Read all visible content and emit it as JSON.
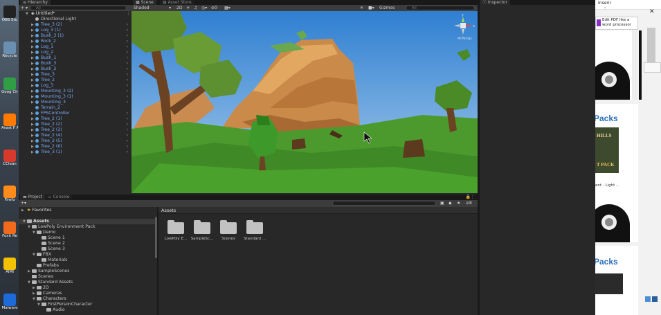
{
  "desktop": {
    "icons": [
      {
        "label": "OBS Stu",
        "color": "#222222"
      },
      {
        "label": "Recycle",
        "color": "#6a8fb0"
      },
      {
        "label": "Goog Chron",
        "color": "#2f9e44"
      },
      {
        "label": "Avast F Antivi",
        "color": "#ff7a00"
      },
      {
        "label": "CClean",
        "color": "#d63a2c"
      },
      {
        "label": "Firefo",
        "color": "#ff8c1a"
      },
      {
        "label": "Foxit Re",
        "color": "#f26b1d"
      },
      {
        "label": "AIMI",
        "color": "#f2c200"
      },
      {
        "label": "Malware",
        "color": "#1d6ad8"
      }
    ]
  },
  "hierarchy": {
    "tab": "Hierarchy",
    "search_placeholder": "All",
    "scene_name": "Untitled*",
    "items": [
      {
        "label": "Directional Light",
        "expandable": false,
        "prefab": false
      },
      {
        "label": "Tree_3 (2)",
        "expandable": true,
        "prefab": true
      },
      {
        "label": "Log_3 (1)",
        "expandable": true,
        "prefab": true
      },
      {
        "label": "Bush_3 (1)",
        "expandable": true,
        "prefab": true
      },
      {
        "label": "Rock_2",
        "expandable": true,
        "prefab": true
      },
      {
        "label": "Log_1",
        "expandable": true,
        "prefab": true
      },
      {
        "label": "Log_2",
        "expandable": true,
        "prefab": true
      },
      {
        "label": "Bush_1",
        "expandable": true,
        "prefab": true
      },
      {
        "label": "Bush_3",
        "expandable": true,
        "prefab": true
      },
      {
        "label": "Bush_2",
        "expandable": true,
        "prefab": true
      },
      {
        "label": "Tree_3",
        "expandable": true,
        "prefab": true
      },
      {
        "label": "Tree_2",
        "expandable": true,
        "prefab": true
      },
      {
        "label": "Log_3",
        "expandable": true,
        "prefab": true
      },
      {
        "label": "Mounting_3 (2)",
        "expandable": true,
        "prefab": true
      },
      {
        "label": "Mounting_3 (1)",
        "expandable": true,
        "prefab": true
      },
      {
        "label": "Mounting_3",
        "expandable": true,
        "prefab": true
      },
      {
        "label": "Terrain_2",
        "expandable": false,
        "prefab": true
      },
      {
        "label": "FPSController",
        "expandable": true,
        "prefab": true
      },
      {
        "label": "Tree_2 (1)",
        "expandable": true,
        "prefab": true
      },
      {
        "label": "Tree_2 (2)",
        "expandable": true,
        "prefab": true
      },
      {
        "label": "Tree_2 (3)",
        "expandable": true,
        "prefab": true
      },
      {
        "label": "Tree_2 (4)",
        "expandable": true,
        "prefab": true
      },
      {
        "label": "Tree_2 (5)",
        "expandable": true,
        "prefab": true
      },
      {
        "label": "Tree_2 (6)",
        "expandable": true,
        "prefab": true
      },
      {
        "label": "Tree_3 (1)",
        "expandable": true,
        "prefab": true
      }
    ]
  },
  "scene": {
    "tab_scene": "Scene",
    "tab_asset_store": "Asset Store",
    "shading_mode": "Shaded",
    "mode_2d": "2D",
    "hidden_count": "0",
    "gizmos_label": "Gizmos",
    "search_placeholder": "All",
    "persp_label": "Persp",
    "axis_labels": {
      "y": "y",
      "x": "x",
      "z": "z"
    }
  },
  "inspector": {
    "tab": "Inspector"
  },
  "project": {
    "tab_project": "Project",
    "tab_console": "Console",
    "favorites_label": "Favorites",
    "assets_label": "Assets",
    "hidden_count": "8",
    "breadcrumb": "Assets",
    "tree": [
      {
        "label": "Assets",
        "depth": 0,
        "open": true,
        "selected": true
      },
      {
        "label": "LowPoly Environment Pack",
        "depth": 1,
        "open": true,
        "selected": false
      },
      {
        "label": "Demo",
        "depth": 2,
        "open": true,
        "selected": false
      },
      {
        "label": "Scene 1",
        "depth": 3,
        "open": null,
        "selected": false
      },
      {
        "label": "Scene 2",
        "depth": 3,
        "open": null,
        "selected": false
      },
      {
        "label": "Scene 3",
        "depth": 3,
        "open": null,
        "selected": false
      },
      {
        "label": "FBX",
        "depth": 2,
        "open": true,
        "selected": false
      },
      {
        "label": "Materials",
        "depth": 3,
        "open": null,
        "selected": false
      },
      {
        "label": "Prefabs",
        "depth": 2,
        "open": null,
        "selected": false
      },
      {
        "label": "SampleScenes",
        "depth": 1,
        "open": false,
        "selected": false
      },
      {
        "label": "Scenes",
        "depth": 1,
        "open": null,
        "selected": false
      },
      {
        "label": "Standard Assets",
        "depth": 1,
        "open": true,
        "selected": false
      },
      {
        "label": "2D",
        "depth": 2,
        "open": false,
        "selected": false
      },
      {
        "label": "Cameras",
        "depth": 2,
        "open": false,
        "selected": false
      },
      {
        "label": "Characters",
        "depth": 2,
        "open": true,
        "selected": false
      },
      {
        "label": "FirstPersonCharacter",
        "depth": 3,
        "open": true,
        "selected": false
      },
      {
        "label": "Audio",
        "depth": 4,
        "open": null,
        "selected": false
      }
    ],
    "folders": [
      "LowPoly E...",
      "SampleSc...",
      "Scenes",
      "Standard ..."
    ]
  },
  "browser": {
    "toolbar_label": "Inserir",
    "ad_text": "Edit PDF like a word processor",
    "packs_label": "Packs",
    "thumb_title": "HILLS",
    "thumb_subtitle": "T PACK",
    "caption": "ent - Light ...",
    "packs_label_2": "Packs"
  }
}
